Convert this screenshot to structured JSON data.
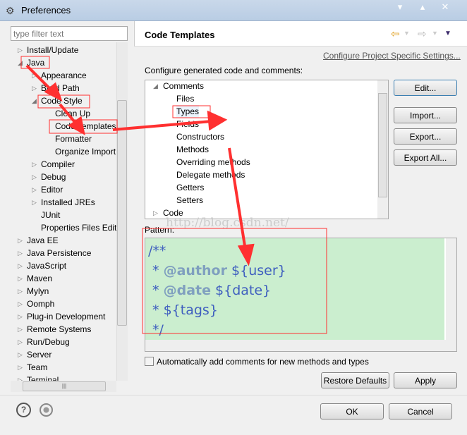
{
  "window": {
    "title": "Preferences",
    "controls": [
      "▾",
      "▴",
      "✕"
    ]
  },
  "filter": {
    "placeholder": "type filter text"
  },
  "tree": [
    {
      "label": "Install/Update",
      "level": 0,
      "state": "collapsed"
    },
    {
      "label": "Java",
      "level": 0,
      "state": "expanded"
    },
    {
      "label": "Appearance",
      "level": 1,
      "state": "collapsed"
    },
    {
      "label": "Build Path",
      "level": 1,
      "state": "collapsed"
    },
    {
      "label": "Code Style",
      "level": 1,
      "state": "expanded"
    },
    {
      "label": "Clean Up",
      "level": 2,
      "state": "leaf"
    },
    {
      "label": "Code Templates",
      "level": 2,
      "state": "leaf"
    },
    {
      "label": "Formatter",
      "level": 2,
      "state": "leaf"
    },
    {
      "label": "Organize Import",
      "level": 2,
      "state": "leaf"
    },
    {
      "label": "Compiler",
      "level": 1,
      "state": "collapsed"
    },
    {
      "label": "Debug",
      "level": 1,
      "state": "collapsed"
    },
    {
      "label": "Editor",
      "level": 1,
      "state": "collapsed"
    },
    {
      "label": "Installed JREs",
      "level": 1,
      "state": "collapsed"
    },
    {
      "label": "JUnit",
      "level": 1,
      "state": "leaf"
    },
    {
      "label": "Properties Files Edito",
      "level": 1,
      "state": "leaf"
    },
    {
      "label": "Java EE",
      "level": 0,
      "state": "collapsed"
    },
    {
      "label": "Java Persistence",
      "level": 0,
      "state": "collapsed"
    },
    {
      "label": "JavaScript",
      "level": 0,
      "state": "collapsed"
    },
    {
      "label": "Maven",
      "level": 0,
      "state": "collapsed"
    },
    {
      "label": "Mylyn",
      "level": 0,
      "state": "collapsed"
    },
    {
      "label": "Oomph",
      "level": 0,
      "state": "collapsed"
    },
    {
      "label": "Plug-in Development",
      "level": 0,
      "state": "collapsed"
    },
    {
      "label": "Remote Systems",
      "level": 0,
      "state": "collapsed"
    },
    {
      "label": "Run/Debug",
      "level": 0,
      "state": "collapsed"
    },
    {
      "label": "Server",
      "level": 0,
      "state": "collapsed"
    },
    {
      "label": "Team",
      "level": 0,
      "state": "collapsed"
    },
    {
      "label": "Terminal",
      "level": 0,
      "state": "collapsed"
    }
  ],
  "page": {
    "title": "Code Templates",
    "link": "Configure Project Specific Settings...",
    "description": "Configure generated code and comments:"
  },
  "templates": [
    {
      "label": "Comments",
      "level": 0,
      "state": "expanded"
    },
    {
      "label": "Files",
      "level": 1
    },
    {
      "label": "Types",
      "level": 1,
      "selected": true
    },
    {
      "label": "Fields",
      "level": 1
    },
    {
      "label": "Constructors",
      "level": 1
    },
    {
      "label": "Methods",
      "level": 1
    },
    {
      "label": "Overriding methods",
      "level": 1
    },
    {
      "label": "Delegate methods",
      "level": 1
    },
    {
      "label": "Getters",
      "level": 1
    },
    {
      "label": "Setters",
      "level": 1
    },
    {
      "label": "Code",
      "level": 0,
      "state": "collapsed"
    }
  ],
  "buttons": {
    "edit": "Edit...",
    "import": "Import...",
    "export": "Export...",
    "export_all": "Export All...",
    "restore": "Restore Defaults",
    "apply": "Apply",
    "ok": "OK",
    "cancel": "Cancel"
  },
  "pattern": {
    "label": "Pattern:",
    "lines": [
      {
        "prefix": "/**",
        "tag": "",
        "var": ""
      },
      {
        "prefix": " * ",
        "tag": "@author",
        "var": " ${user}"
      },
      {
        "prefix": " * ",
        "tag": "@date",
        "var": " ${date}"
      },
      {
        "prefix": " * ",
        "tag": "",
        "var": "${tags}"
      },
      {
        "prefix": " */",
        "tag": "",
        "var": ""
      }
    ]
  },
  "auto_comment": {
    "label": "Automatically add comments for new methods and types",
    "checked": false
  },
  "watermark": "http://blog.csdn.net/",
  "colors": {
    "annotation": "#ff3030",
    "editor_bg": "#cbeecf",
    "comment": "#3f5fbf",
    "javadoc_tag": "#7f9fbf"
  }
}
